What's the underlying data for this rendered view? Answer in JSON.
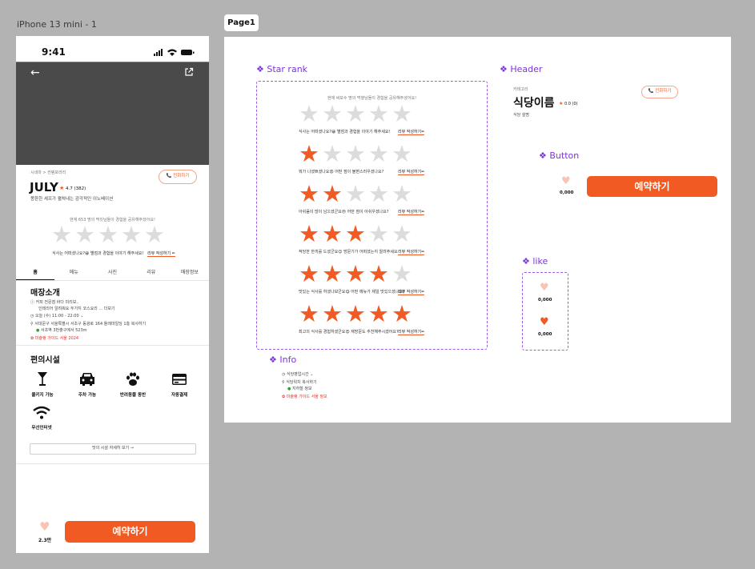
{
  "frame": {
    "label": "iPhone 13 mini - 1"
  },
  "status_bar": {
    "time": "9:41"
  },
  "restaurant": {
    "breadcrumb": "시네마 > 컨템포러리",
    "name": "JULY",
    "rating": "4.7 (382)",
    "desc": "몽환한 셰프가 펼쳐내는 감각적인 이노베이션",
    "call_label": "전화하기"
  },
  "rating_prompt": {
    "intro": "현재 653 명의 먹킷님들이 경험을 공유해주셨어요!",
    "question": "식사는 어떠셨나요?😀 별점과 경험을 이야기 해주세요!",
    "review_button": "리뷰 작성하기 ✏"
  },
  "tabs": [
    "홈",
    "메뉴",
    "사진",
    "리뷰",
    "매장정보"
  ],
  "store": {
    "title": "매장소개",
    "lines": [
      "커피 전문점 바다 미리보..",
      "인테리어 알려줘요 두가지 코스요리 ... 더보기",
      "오늘 (수) 11:00 - 22:00 ⌄",
      "서대문구 서울특별시 서초구 동광로 164 돌레마일딩 1층 복사하기",
      "서초역 3번출구에서 523m",
      "미슐랭 가이드 서울 2024"
    ]
  },
  "facilities": {
    "title": "편의시설",
    "items": [
      "콜키지 가능",
      "주차 가능",
      "반려동물 동반",
      "자동결제",
      "무선인터넷"
    ],
    "more_button": "맛의 시설 자세히 보기 →"
  },
  "bottom": {
    "like_count": "2.3만",
    "reserve_label": "예약하기"
  },
  "page_tag": "Page1",
  "components": {
    "star_rank": {
      "label": "Star rank",
      "intro": "현재 써보수 명의 먹행님들이 경험을 공유해주셨어요!",
      "rows": [
        {
          "filled": 0,
          "text": "식사는 어떠셨나요?😀 별점과 경험을 이야기 해주세요!",
          "link": "리뷰 작성하기✏"
        },
        {
          "filled": 1,
          "text": "뭐가 나셨쁘셨나요😟 어떤 점이 불편스러우셨나요?",
          "link": "리뷰 작성하기✏"
        },
        {
          "filled": 2,
          "text": "아쉬움이 많이 남으셨군요😔 어떤 점이 아쉬우셨나요?",
          "link": "리뷰 작성하기✏"
        },
        {
          "filled": 3,
          "text": "적당한 한끼를 드셨군요😊 방문기가 어떠셨는지 알려주세요",
          "link": "리뷰 작성하기✏"
        },
        {
          "filled": 4,
          "text": "맛있는 식사를 하셨나보군요😋 어떤 메뉴가 제일 맛있으셨나요?",
          "link": "리뷰 작성하기✏"
        },
        {
          "filled": 5,
          "text": "최고의 식사를 경험하셨군요😍 재방문도 추천해주시겠어요?",
          "link": "리뷰 작성하기✏"
        }
      ]
    },
    "header": {
      "label": "Header",
      "category": "카테고리",
      "name": "식당이름",
      "rating": "0.0 (0)",
      "desc": "식당 설명",
      "call_label": "전화하기"
    },
    "button": {
      "label": "Button",
      "count": "0,000",
      "reserve_label": "예약하기"
    },
    "like": {
      "label": "like",
      "count_off": "0,000",
      "count_on": "0,000"
    },
    "info": {
      "label": "Info",
      "hours": "식당영업시간 ⌄",
      "location": "식당위치 복사하기",
      "distance": "지하철 정보",
      "guide": "미슐랭 가이드 서울 정보"
    }
  },
  "colors": {
    "accent": "#f15a22",
    "star_off": "#dcdcdc",
    "component_purple": "#7a35d6",
    "hero_gray": "#4a4a4a"
  }
}
